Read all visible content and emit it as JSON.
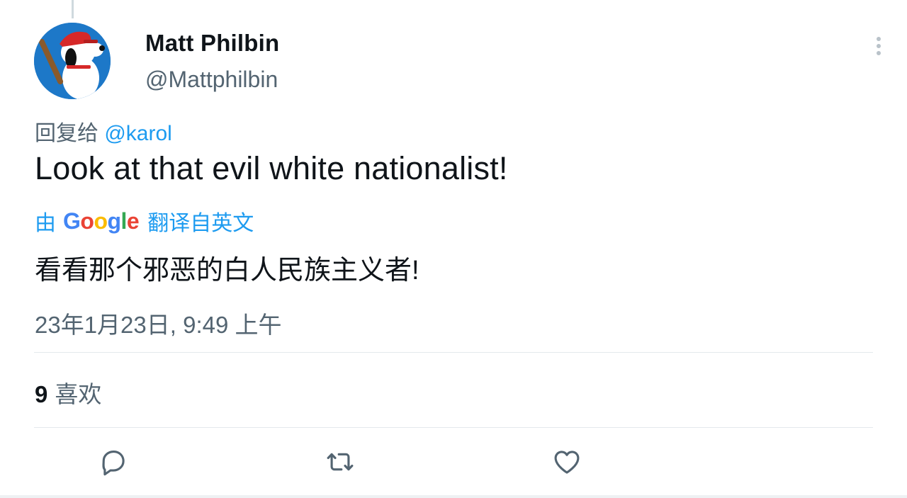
{
  "author": {
    "display_name": "Matt Philbin",
    "handle": "@Mattphilbin"
  },
  "reply": {
    "prefix": "回复给",
    "mention": "@karol"
  },
  "tweet": {
    "text": "Look at that evil white nationalist!"
  },
  "translation": {
    "prefix": "由",
    "provider": "Google",
    "suffix": "翻译自英文",
    "text": "看看那个邪恶的白人民族主义者!"
  },
  "meta": {
    "timestamp": "23年1月23日, 9:49 上午"
  },
  "stats": {
    "likes_count": "9",
    "likes_label": "喜欢"
  },
  "colors": {
    "accent": "#1d9bf0",
    "secondary_text": "#536471",
    "primary_text": "#0f1419"
  },
  "icons": {
    "more": "more-vertical-icon",
    "reply": "reply-icon",
    "retweet": "retweet-icon",
    "like": "heart-icon"
  }
}
